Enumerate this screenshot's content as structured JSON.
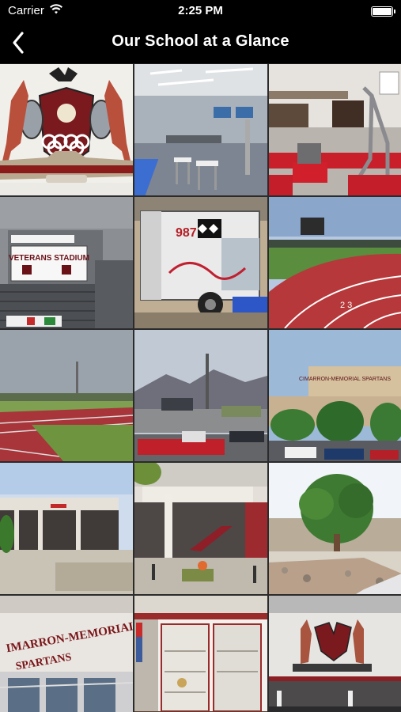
{
  "status_bar": {
    "carrier": "Carrier",
    "time": "2:25 PM",
    "battery_level": 1.0
  },
  "nav": {
    "title": "Our School at a Glance",
    "back_icon": "chevron-left-icon"
  },
  "gallery": {
    "photos": [
      {
        "name": "spartans-logo-photo"
      },
      {
        "name": "classroom-lab-photo"
      },
      {
        "name": "robotics-room-photo"
      },
      {
        "name": "veterans-stadium-photo",
        "sign_text": "VETERANS STADIUM"
      },
      {
        "name": "robotics-trailer-photo",
        "trailer_text": "987"
      },
      {
        "name": "scoreboard-track-photo"
      },
      {
        "name": "track-field-photo"
      },
      {
        "name": "parking-lot-mountains-photo"
      },
      {
        "name": "school-building-sign-photo",
        "sign_text": "CIMARRON-MEMORIAL SPARTANS"
      },
      {
        "name": "campus-courtyard-photo"
      },
      {
        "name": "school-entrance-photo"
      },
      {
        "name": "tree-landscape-photo"
      },
      {
        "name": "cimarron-memorial-facade-photo",
        "facade_text": "IMARRON-MEMORIAL",
        "facade_text2": "SPARTANS"
      },
      {
        "name": "trophy-hall-photo"
      },
      {
        "name": "cafeteria-mural-photo"
      }
    ]
  },
  "colors": {
    "bar_background": "#000000",
    "spartan_red": "#8b1a1a"
  }
}
